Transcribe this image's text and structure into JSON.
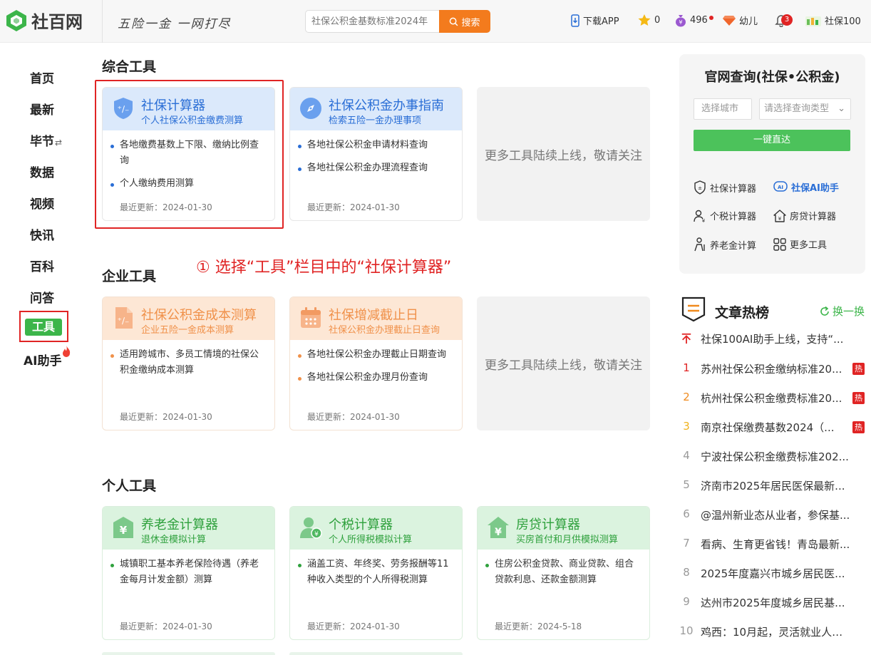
{
  "header": {
    "logo_text": "社百网",
    "slogan": "五险一金 一网打尽",
    "search_placeholder": "社保公积金基数标准2024年",
    "search_button": "搜索",
    "download_app": "下载APP",
    "points": "0",
    "coins": "496",
    "child": "幼儿",
    "notifications": "3",
    "username": "社保100"
  },
  "nav": {
    "home": "首页",
    "latest": "最新",
    "city": "毕节",
    "city_switch": "⇄",
    "data": "数据",
    "video": "视频",
    "news": "快讯",
    "wiki": "百科",
    "qa": "问答",
    "tools": "工具",
    "ai": "AI助手"
  },
  "annotation": "① 选择“工具”栏目中的“社保计算器”",
  "sections": {
    "general": {
      "title": "综合工具",
      "cards": [
        {
          "title": "社保计算器",
          "subtitle": "个人社保公积金缴费测算",
          "bullets": [
            "各地缴费基数上下限、缴纳比例查询",
            "个人缴纳费用测算"
          ],
          "date": "最近更新：2024-01-30"
        },
        {
          "title": "社保公积金办事指南",
          "subtitle": "检索五险一金办理事项",
          "bullets": [
            "各地社保公积金申请材料查询",
            "各地社保公积金办理流程查询"
          ],
          "date": "最近更新：2024-01-30"
        }
      ],
      "more": "更多工具陆续上线，敬请关注"
    },
    "enterprise": {
      "title": "企业工具",
      "cards": [
        {
          "title": "社保公积金成本测算",
          "subtitle": "企业五险一金成本测算",
          "bullets": [
            "适用跨城市、多员工情境的社保公积金缴纳成本测算"
          ],
          "date": "最近更新：2024-01-30"
        },
        {
          "title": "社保增减截止日",
          "subtitle": "社保公积金办理截止日查询",
          "bullets": [
            "各地社保公积金办理截止日期查询",
            "各地社保公积金办理月份查询"
          ],
          "date": "最近更新：2024-01-30"
        }
      ],
      "more": "更多工具陆续上线，敬请关注"
    },
    "personal": {
      "title": "个人工具",
      "cards": [
        {
          "title": "养老金计算器",
          "subtitle": "退休金模拟计算",
          "bullets": [
            "城镇职工基本养老保险待遇（养老金每月计发金额）测算"
          ],
          "date": "最近更新：2024-01-30"
        },
        {
          "title": "个税计算器",
          "subtitle": "个人所得税模拟计算",
          "bullets": [
            "涵盖工资、年终奖、劳务报酬等11种收入类型的个人所得税测算"
          ],
          "date": "最近更新：2024-01-30"
        },
        {
          "title": "房贷计算器",
          "subtitle": "买房首付和月供模拟测算",
          "bullets": [
            "住房公积金贷款、商业贷款、组合贷款利息、还款金额测算"
          ],
          "date": "最近更新：2024-5-18"
        }
      ]
    }
  },
  "query": {
    "title": "官网查询(社保•公积金)",
    "city_placeholder": "选择城市",
    "type_placeholder": "请选择查询类型",
    "go_button": "一键直达",
    "tools": [
      "社保计算器",
      "社保AI助手",
      "个税计算器",
      "房贷计算器",
      "养老金计算",
      "更多工具"
    ]
  },
  "hot": {
    "title": "文章热榜",
    "refresh": "换一换",
    "badge": "热",
    "items": [
      {
        "rank": "",
        "text": "社保100AI助手上线，支持“..."
      },
      {
        "rank": "1",
        "text": "苏州社保公积金缴纳标准20..."
      },
      {
        "rank": "2",
        "text": "杭州社保公积金缴费标准20..."
      },
      {
        "rank": "3",
        "text": "南京社保缴费基数2024（..."
      },
      {
        "rank": "4",
        "text": "宁波社保公积金缴费标准202..."
      },
      {
        "rank": "5",
        "text": "济南市2025年居民医保最新..."
      },
      {
        "rank": "6",
        "text": "@温州新业态从业者，参保基..."
      },
      {
        "rank": "7",
        "text": "看病、生育更省钱！青岛最新..."
      },
      {
        "rank": "8",
        "text": "2025年度嘉兴市城乡居民医..."
      },
      {
        "rank": "9",
        "text": "达州市2025年度城乡居民基..."
      },
      {
        "rank": "10",
        "text": "鸡西：10月起，灵活就业人员..."
      }
    ]
  },
  "colors": {
    "brand_green": "#3cb54a",
    "accent_orange": "#f37b1d",
    "highlight_red": "#e02424",
    "card_blue": "#2a6ed6"
  }
}
